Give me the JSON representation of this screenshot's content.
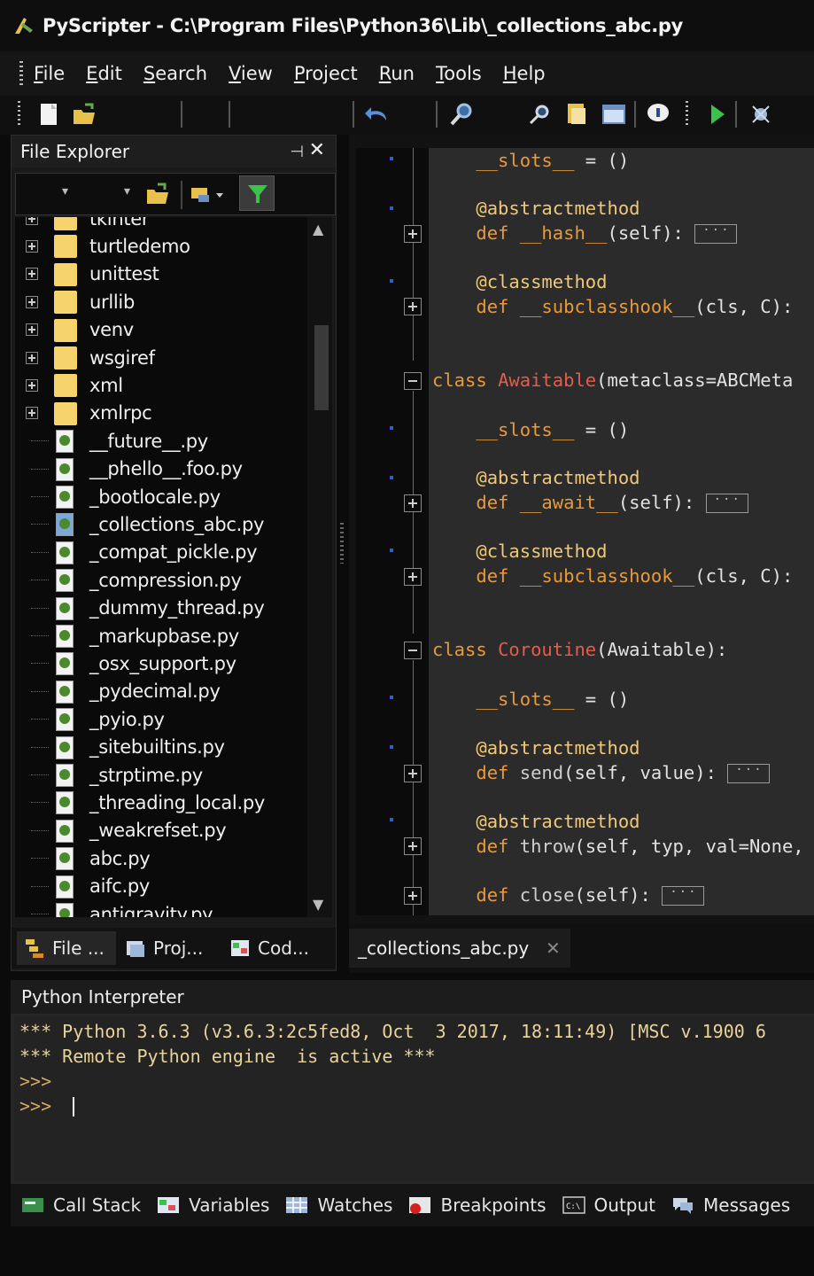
{
  "window": {
    "title": "PyScripter - C:\\Program Files\\Python36\\Lib\\_collections_abc.py"
  },
  "menu": [
    {
      "label": "File"
    },
    {
      "label": "Edit"
    },
    {
      "label": "Search"
    },
    {
      "label": "View"
    },
    {
      "label": "Project"
    },
    {
      "label": "Run"
    },
    {
      "label": "Tools"
    },
    {
      "label": "Help"
    }
  ],
  "file_explorer": {
    "title": "File Explorer",
    "pin_icon": "pin-icon",
    "close_glyph": "✕",
    "tree": [
      {
        "label": "tkinter",
        "type": "folder"
      },
      {
        "label": "turtledemo",
        "type": "folder"
      },
      {
        "label": "unittest",
        "type": "folder"
      },
      {
        "label": "urllib",
        "type": "folder"
      },
      {
        "label": "venv",
        "type": "folder"
      },
      {
        "label": "wsgiref",
        "type": "folder"
      },
      {
        "label": "xml",
        "type": "folder"
      },
      {
        "label": "xmlrpc",
        "type": "folder"
      },
      {
        "label": "__future__.py",
        "type": "file"
      },
      {
        "label": "__phello__.foo.py",
        "type": "file"
      },
      {
        "label": "_bootlocale.py",
        "type": "file"
      },
      {
        "label": "_collections_abc.py",
        "type": "file",
        "selected": true
      },
      {
        "label": "_compat_pickle.py",
        "type": "file"
      },
      {
        "label": "_compression.py",
        "type": "file"
      },
      {
        "label": "_dummy_thread.py",
        "type": "file"
      },
      {
        "label": "_markupbase.py",
        "type": "file"
      },
      {
        "label": "_osx_support.py",
        "type": "file"
      },
      {
        "label": "_pydecimal.py",
        "type": "file"
      },
      {
        "label": "_pyio.py",
        "type": "file"
      },
      {
        "label": "_sitebuiltins.py",
        "type": "file"
      },
      {
        "label": "_strptime.py",
        "type": "file"
      },
      {
        "label": "_threading_local.py",
        "type": "file"
      },
      {
        "label": "_weakrefset.py",
        "type": "file"
      },
      {
        "label": "abc.py",
        "type": "file"
      },
      {
        "label": "aifc.py",
        "type": "file"
      },
      {
        "label": "antigravity.py",
        "type": "file"
      }
    ],
    "tabs": [
      {
        "label": "File ...",
        "icon": "file-explorer-icon"
      },
      {
        "label": "Proj...",
        "icon": "project-icon"
      },
      {
        "label": "Cod...",
        "icon": "code-explorer-icon"
      }
    ]
  },
  "editor": {
    "tab_label": "_collections_abc.py",
    "tab_close": "✕"
  },
  "interpreter": {
    "title": "Python Interpreter",
    "lines": [
      "*** Python 3.6.3 (v3.6.3:2c5fed8, Oct  3 2017, 18:11:49) [MSC v.1900 6",
      "*** Remote Python engine  is active ***",
      ">>>",
      ">>> "
    ]
  },
  "bottom_tabs": [
    {
      "label": "Call Stack",
      "icon": "call-stack-icon"
    },
    {
      "label": "Variables",
      "icon": "variables-icon"
    },
    {
      "label": "Watches",
      "icon": "watches-icon"
    },
    {
      "label": "Breakpoints",
      "icon": "breakpoints-icon"
    },
    {
      "label": "Output",
      "icon": "output-icon"
    },
    {
      "label": "Messages",
      "icon": "messages-icon"
    }
  ]
}
